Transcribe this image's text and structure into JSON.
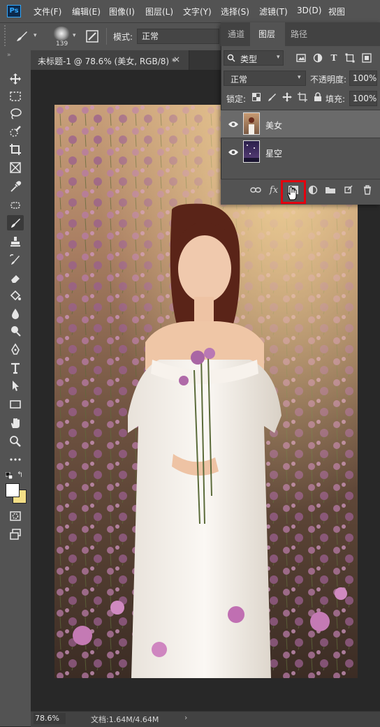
{
  "app": {
    "logo": "Ps"
  },
  "menu": [
    "文件(F)",
    "编辑(E)",
    "图像(I)",
    "图层(L)",
    "文字(Y)",
    "选择(S)",
    "滤镜(T)",
    "3D(D)",
    "视图"
  ],
  "options": {
    "brush_size": "139",
    "mode_label": "模式:",
    "mode_value": "正常"
  },
  "document_tab": {
    "title": "未标题-1 @ 78.6% (美女, RGB/8) *",
    "close": "×"
  },
  "status": {
    "zoom": "78.6%",
    "doc_info": "文档:1.64M/4.64M",
    "arrow": "›"
  },
  "panel": {
    "tabs": [
      "通道",
      "图层",
      "路径"
    ],
    "active_tab": "图层",
    "filter_label": "类型",
    "blend_mode": "正常",
    "opacity_label": "不透明度:",
    "opacity_value": "100%",
    "lock_label": "锁定:",
    "fill_label": "填充:",
    "fill_value": "100%",
    "layers": [
      {
        "name": "美女",
        "visible": true,
        "selected": true
      },
      {
        "name": "星空",
        "visible": true,
        "selected": false
      }
    ],
    "bottom_fx": "fx"
  },
  "colors": {
    "ui_bg": "#535353",
    "canvas_bg": "#282828",
    "highlight": "#e3000e",
    "foreground_swatch": "#ffffff",
    "background_swatch": "#f4df86"
  },
  "icons": {
    "tools": [
      "move-icon",
      "marquee-icon",
      "lasso-icon",
      "quick-select-icon",
      "crop-icon",
      "frame-icon",
      "eyedropper-icon",
      "patch-icon",
      "brush-icon",
      "stamp-icon",
      "history-brush-icon",
      "eraser-icon",
      "paint-bucket-icon",
      "blur-icon",
      "dodge-icon",
      "pen-icon",
      "type-icon",
      "path-select-icon",
      "rectangle-icon",
      "hand-icon",
      "zoom-icon",
      "more-icon"
    ]
  }
}
